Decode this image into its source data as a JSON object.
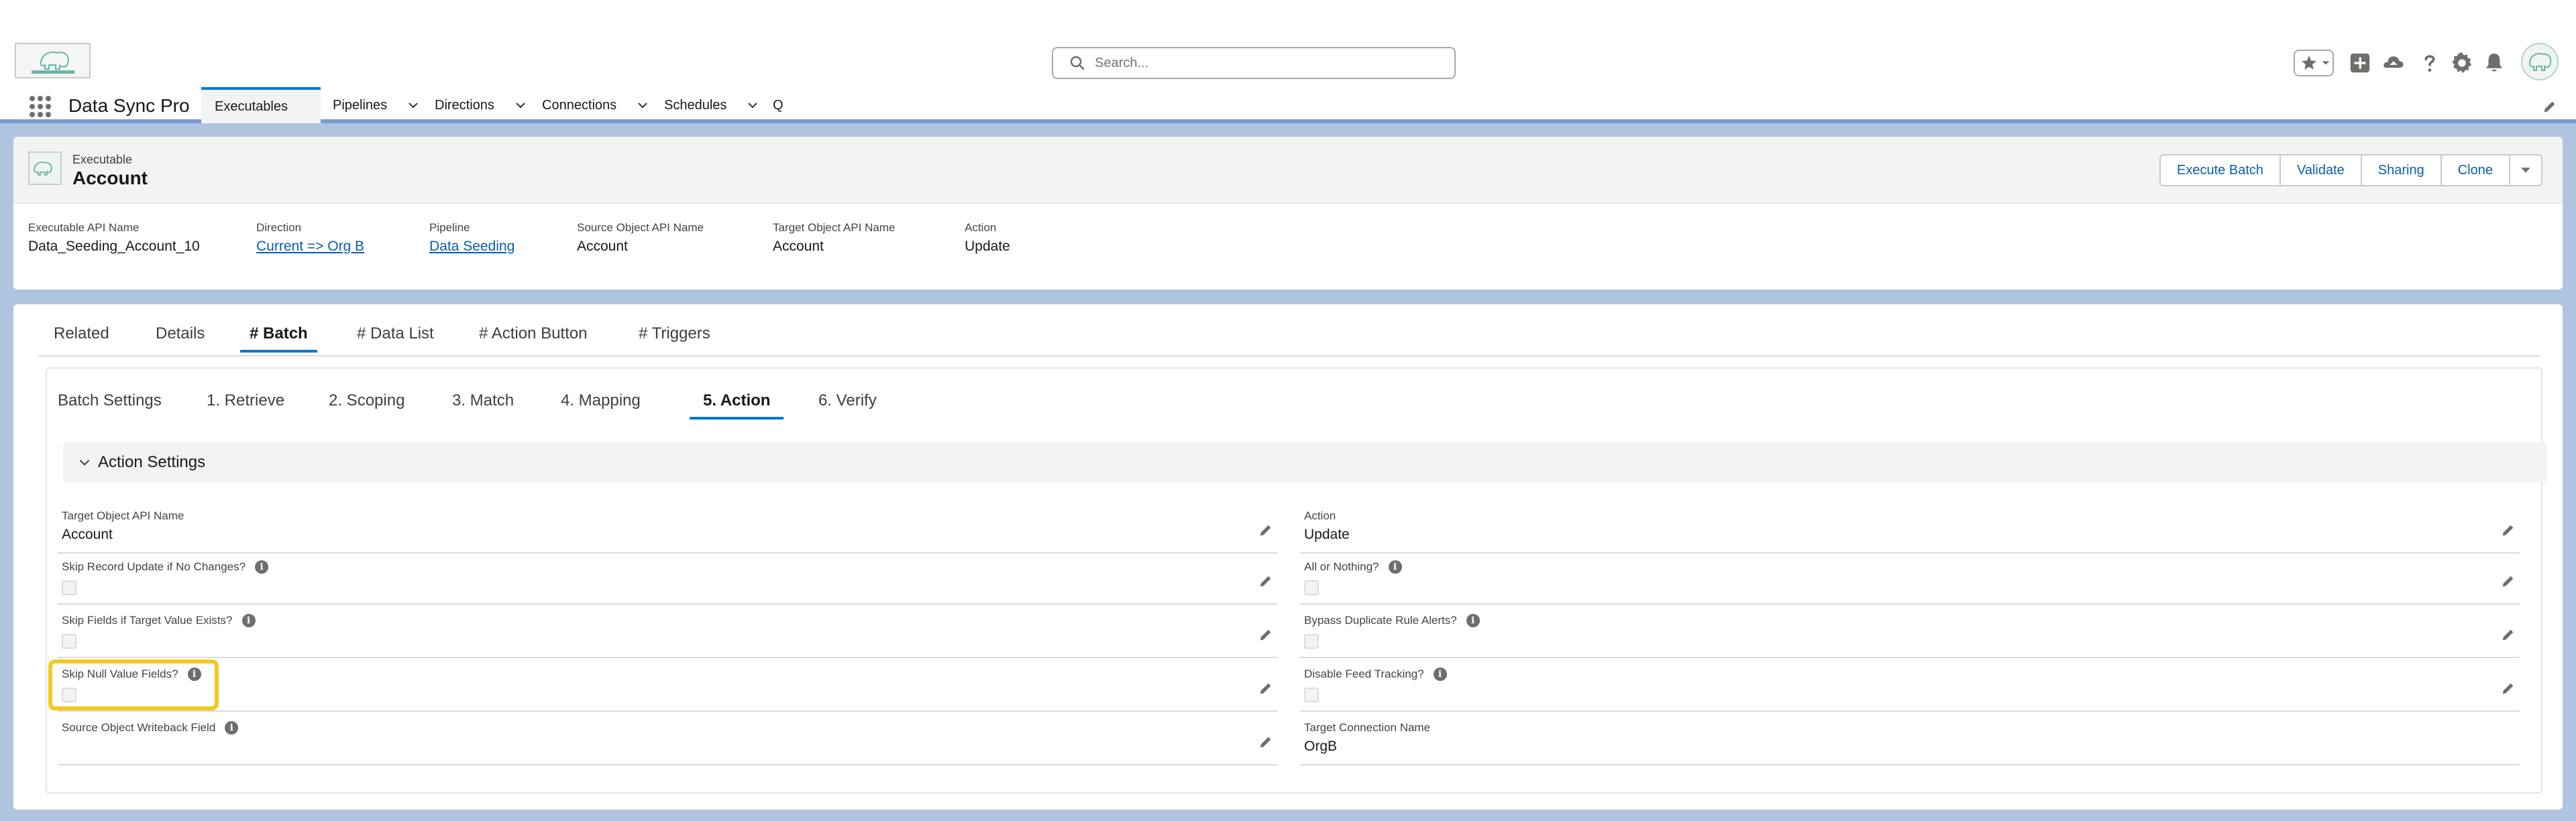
{
  "header": {
    "search_placeholder": "Search...",
    "icons": [
      "favorites-star-icon",
      "chevron-down-icon",
      "add-icon",
      "trailhead-icon",
      "help-icon",
      "setup-gear-icon",
      "notifications-bell-icon",
      "user-avatar"
    ]
  },
  "nav": {
    "app_name": "Data Sync Pro",
    "items": [
      {
        "label": "Executables",
        "active": true
      },
      {
        "label": "Pipelines"
      },
      {
        "label": "Directions"
      },
      {
        "label": "Connections"
      },
      {
        "label": "Schedules"
      },
      {
        "label": "Q"
      }
    ]
  },
  "record": {
    "type": "Executable",
    "name": "Account",
    "actions": [
      "Execute Batch",
      "Validate",
      "Sharing",
      "Clone"
    ],
    "highlights": [
      {
        "label": "Executable API Name",
        "value": "Data_Seeding_Account_10"
      },
      {
        "label": "Direction",
        "value": "Current => Org B"
      },
      {
        "label": "Pipeline",
        "value": "Data Seeding"
      },
      {
        "label": "Source Object API Name",
        "value": "Account"
      },
      {
        "label": "Target Object API Name",
        "value": "Account"
      },
      {
        "label": "Action",
        "value": "Update"
      }
    ]
  },
  "tabs": [
    "Related",
    "Details",
    "# Batch",
    "# Data List",
    "# Action Button",
    "# Triggers"
  ],
  "subtabs": [
    "Batch Settings",
    "1. Retrieve",
    "2. Scoping",
    "3. Match",
    "4. Mapping",
    "5. Action",
    "6. Verify"
  ],
  "section": {
    "title": "Action Settings",
    "left_fields": [
      {
        "label": "Target Object API Name",
        "value": "Account"
      },
      {
        "label": "Skip Record Update if No Changes?"
      },
      {
        "label": "Skip Fields if Target Value Exists?"
      },
      {
        "label": "Skip Null Value Fields?"
      },
      {
        "label": "Source Object Writeback Field",
        "value": ""
      }
    ],
    "right_fields": [
      {
        "label": "Action",
        "value": "Update"
      },
      {
        "label": "All or Nothing?"
      },
      {
        "label": "Bypass Duplicate Rule Alerts?"
      },
      {
        "label": "Disable Feed Tracking?"
      },
      {
        "label": "Target Connection Name",
        "value": "OrgB"
      }
    ]
  },
  "colors": {
    "brand_blue": "#0176d3",
    "link_blue": "#0b5cab",
    "highlight_yellow": "#f4c91e",
    "background": "#b0c4df"
  }
}
